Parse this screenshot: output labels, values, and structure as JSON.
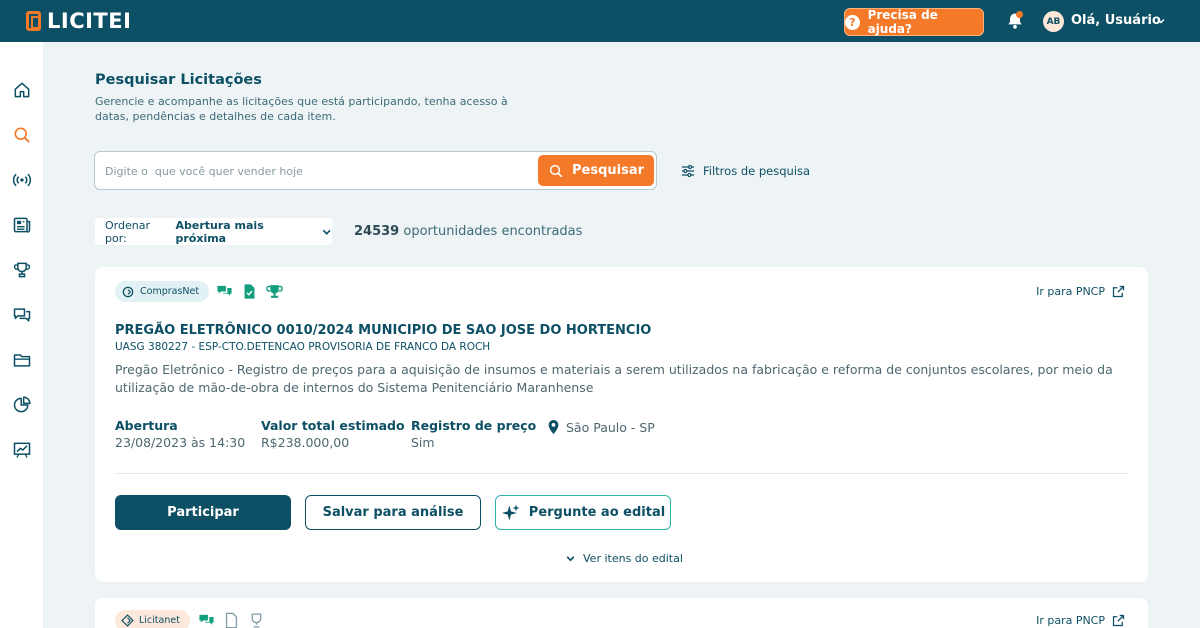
{
  "app": {
    "name": "LICITEI"
  },
  "topbar": {
    "help_label": "Precisa de ajuda?",
    "avatar_initials": "AB",
    "user_greeting": "Olá, Usuário"
  },
  "sidebar": {
    "items": [
      {
        "icon": "home-icon"
      },
      {
        "icon": "search-icon",
        "active": true
      },
      {
        "icon": "broadcast-icon"
      },
      {
        "icon": "newspaper-icon"
      },
      {
        "icon": "trophy-icon"
      },
      {
        "icon": "chat-icon"
      },
      {
        "icon": "folder-icon"
      },
      {
        "icon": "pie-chart-icon"
      },
      {
        "icon": "trend-chart-icon"
      }
    ]
  },
  "page": {
    "title": "Pesquisar Licitações",
    "description": "Gerencie e acompanhe as licitações que está participando, tenha acesso à datas, pendências e detalhes de cada item."
  },
  "search": {
    "placeholder": "Digite o  que você quer vender hoje",
    "button_label": "Pesquisar",
    "filters_label": "Filtros de pesquisa"
  },
  "sort": {
    "label": "Ordenar por:",
    "value": "Abertura mais próxima"
  },
  "results": {
    "count": "24539",
    "label": "oportunidades encontradas"
  },
  "cards": [
    {
      "source": "ComprasNet",
      "pncp_label": "Ir para PNCP",
      "title": "PREGÃO ELETRÔNICO 0010/2024 MUNICIPIO DE SAO JOSE DO HORTENCIO",
      "subtitle": "UASG 380227 - ESP-CTO.DETENCAO PROVISORIA DE FRANCO DA ROCH",
      "description": "Pregão Eletrônico - Registro de preços para a aquisição de insumos e materiais a serem utilizados na fabricação e reforma de conjuntos escolares, por meio da utilização de mão-de-obra de internos do Sistema Penitenciário Maranhense",
      "abertura_label": "Abertura",
      "abertura_value": "23/08/2023 às 14:30",
      "valor_label": "Valor total estimado",
      "valor_value": "R$238.000,00",
      "registro_label": "Registro de preço",
      "registro_value": "Sim",
      "location": "São Paulo - SP",
      "participar_label": "Participar",
      "salvar_label": "Salvar para análise",
      "pergunte_label": "Pergunte ao edital",
      "ver_itens_label": "Ver itens do edital"
    },
    {
      "source": "Licitanet",
      "pncp_label": "Ir para PNCP"
    }
  ],
  "colors": {
    "brand_dark": "#0d4f64",
    "accent_orange": "#f47a2a",
    "accent_teal": "#2bb5a8",
    "background": "#eef4f6"
  }
}
